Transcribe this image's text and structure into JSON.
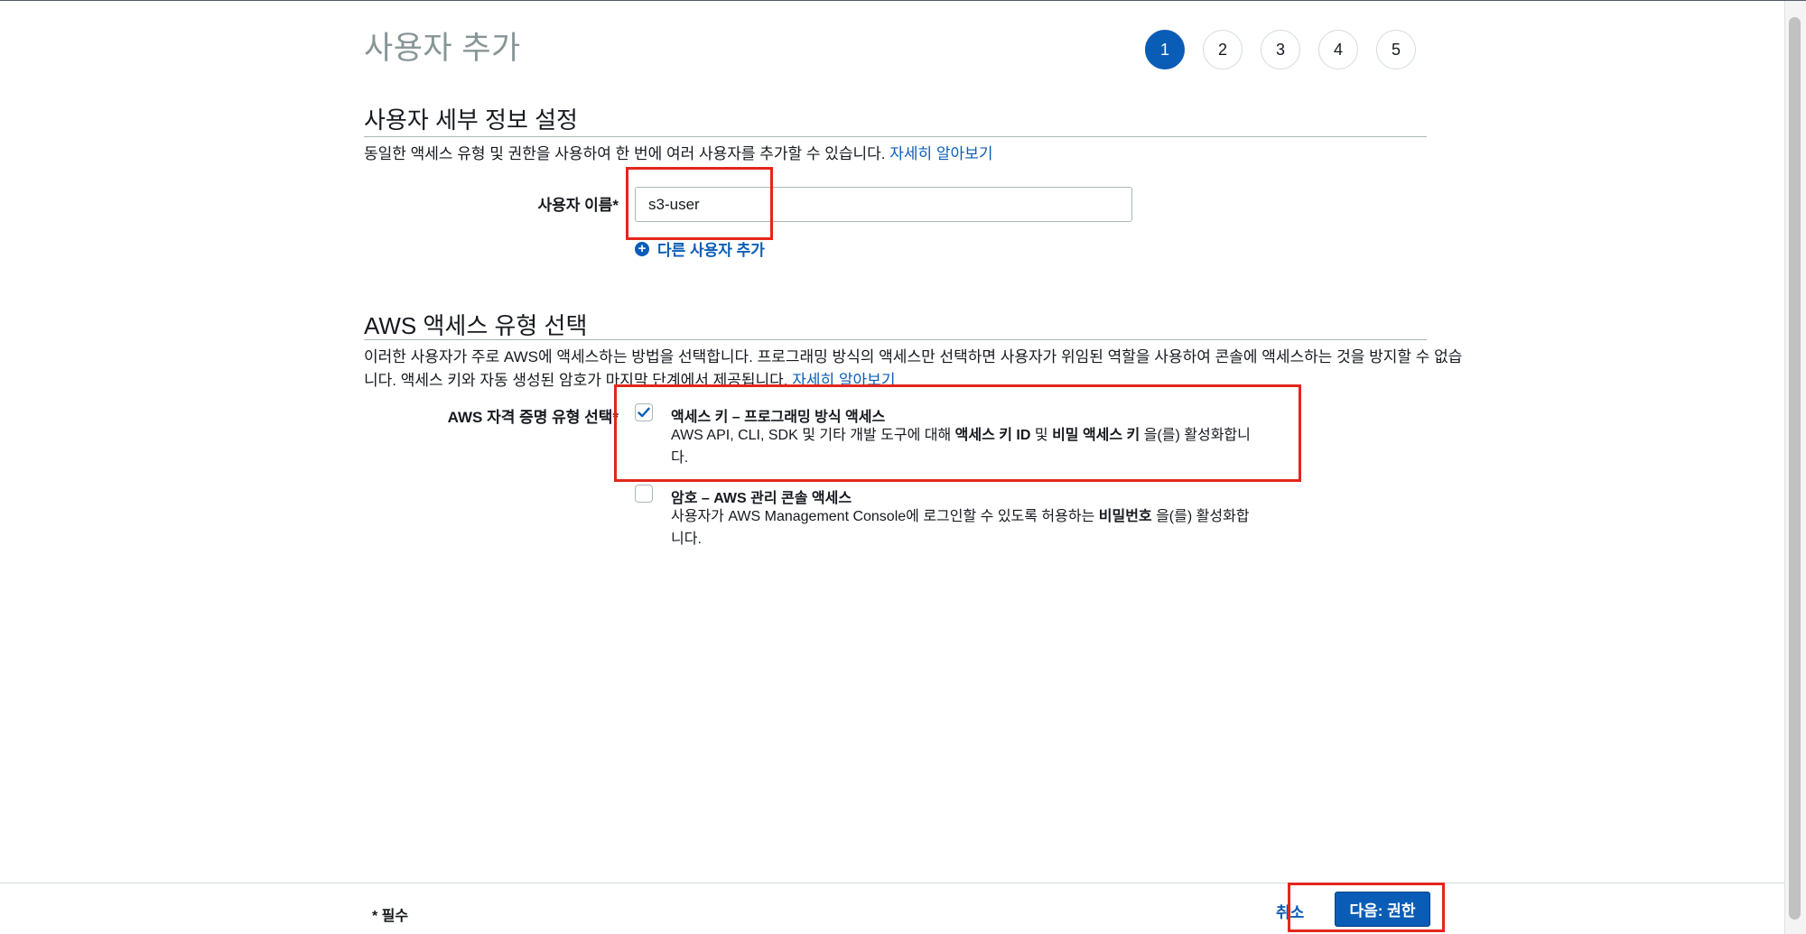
{
  "page": {
    "title": "사용자 추가"
  },
  "wizard": {
    "steps": [
      "1",
      "2",
      "3",
      "4",
      "5"
    ],
    "active_step": 1
  },
  "user_details": {
    "heading": "사용자 세부 정보 설정",
    "description": "동일한 액세스 유형 및 권한을 사용하여 한 번에 여러 사용자를 추가할 수 있습니다.",
    "learn_more": "자세히 알아보기",
    "username_label": "사용자 이름*",
    "username_value": "s3-user",
    "add_another_user": "다른 사용자 추가"
  },
  "access_type": {
    "heading": "AWS 액세스 유형 선택",
    "description_line1": "이러한 사용자가 주로 AWS에 액세스하는 방법을 선택합니다. 프로그래밍 방식의 액세스만 선택하면 사용자가 위임된 역할을 사용하여 콘솔에 액세스하는 것을 방지할 수 없습",
    "description_line2": "니다. 액세스 키와 자동 생성된 암호가 마지막 단계에서 제공됩니다.",
    "learn_more": "자세히 알아보기",
    "credential_label": "AWS 자격 증명 유형 선택*",
    "options": [
      {
        "title": "액세스 키 – 프로그래밍 방식 액세스",
        "desc_prefix": "AWS API, CLI, SDK 및 기타 개발 도구에 대해 ",
        "desc_bold1": "액세스 키 ID",
        "desc_mid": " 및 ",
        "desc_bold2": "비밀 액세스 키",
        "desc_suffix": " 을(를) 활성화합니",
        "desc_line2": "다.",
        "checked": true
      },
      {
        "title": "암호 – AWS 관리 콘솔 액세스",
        "desc_prefix": "사용자가 AWS Management Console에 로그인할 수 있도록 허용하는 ",
        "desc_bold1": "비밀번호",
        "desc_suffix": " 을(를) 활성화합",
        "desc_line2": "니다.",
        "checked": false
      }
    ]
  },
  "footer": {
    "required_note": "* 필수",
    "cancel_label": "취소",
    "next_label": "다음: 권한"
  },
  "colors": {
    "accent": "#0a5db6",
    "highlight": "#e3261c"
  },
  "icons": {
    "checkmark": "check-icon",
    "add": "plus-circle-icon"
  }
}
